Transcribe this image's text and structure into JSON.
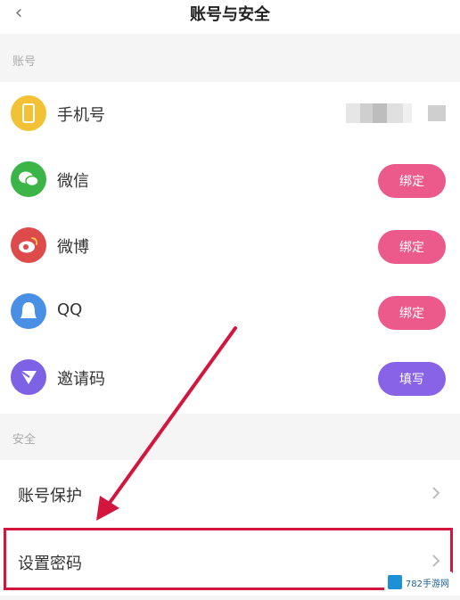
{
  "header": {
    "title": "账号与安全"
  },
  "sections": {
    "account_label": "账号",
    "security_label": "安全"
  },
  "account_rows": [
    {
      "label": "手机号",
      "icon": "phone-icon",
      "color": "#f2c135"
    },
    {
      "label": "微信",
      "icon": "wechat-icon",
      "color": "#3bb548",
      "button": "绑定",
      "button_color": "#ec5a8c"
    },
    {
      "label": "微博",
      "icon": "weibo-icon",
      "color": "#dd4b4b",
      "button": "绑定",
      "button_color": "#ec5a8c"
    },
    {
      "label": "QQ",
      "icon": "qq-icon",
      "color": "#4a8fe6",
      "button": "绑定",
      "button_color": "#ec5a8c"
    },
    {
      "label": "邀请码",
      "icon": "paper-plane-icon",
      "color": "#7e62e6",
      "button": "填写",
      "button_color": "#8863e8"
    }
  ],
  "security_rows": [
    {
      "label": "账号保护"
    },
    {
      "label": "设置密码"
    }
  ],
  "annotation": {
    "arrow_color": "#d4163e"
  },
  "watermark": {
    "text": "782手游网"
  }
}
